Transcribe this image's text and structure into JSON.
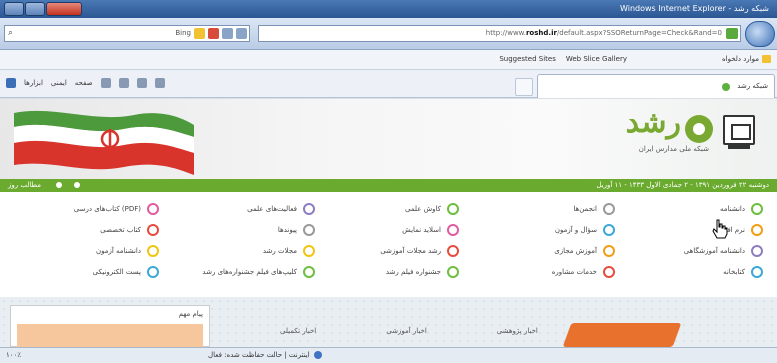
{
  "window": {
    "title": "Windows Internet Explorer - شبکه رشد",
    "controls": [
      "minimize",
      "maximize",
      "close"
    ]
  },
  "address_bar": {
    "url_prefix": "http://www.",
    "url_domain": "roshd.ir",
    "url_rest": "/default.aspx?SSOReturnPage=Check&Rand=0",
    "search_provider": "Bing",
    "search_icon": "search-icon",
    "nav_icon": "back-forward-icon"
  },
  "favorites_bar": {
    "label": "موارد دلخواه",
    "items": [
      "Web Slice Gallery",
      "Suggested Sites"
    ]
  },
  "command_bar": {
    "tab_title": "شبکه رشد",
    "commands": [
      "ابزارها",
      "ایمنی",
      "صفحه"
    ]
  },
  "page": {
    "logo_text": "رشد",
    "logo_subtitle": "شبکه ملی مدارس ایران",
    "date_text": "دوشنبه ۲۲ فروردین ۱۳۹۱ - ۲ جمادی الاول ۱۴۳۳ - ۱۱ آوریل",
    "greenbar_left": "مطالب روز",
    "menu": {
      "col1": [
        {
          "label": "دانشنامه",
          "color": "#6cbf3c"
        },
        {
          "label": "نرم افزار",
          "color": "#f39c12"
        },
        {
          "label": "دانشنامه آموزشگاهی",
          "color": "#8e7cc3"
        },
        {
          "label": "کتابخانه",
          "color": "#3aa7d8"
        }
      ],
      "col2": [
        {
          "label": "انجمن‌ها",
          "color": "#999999"
        },
        {
          "label": "سؤال و آزمون",
          "color": "#3aa7d8"
        },
        {
          "label": "آموزش مجازی",
          "color": "#f39c12"
        },
        {
          "label": "خدمات مشاوره",
          "color": "#e84a3c"
        }
      ],
      "col3": [
        {
          "label": "کاوش علمی",
          "color": "#6cbf3c"
        },
        {
          "label": "اسلاید نمایش",
          "color": "#e25aa0"
        },
        {
          "label": "رشد مجلات آموزشی",
          "color": "#e84a3c"
        },
        {
          "label": "جشنواره فیلم رشد",
          "color": "#6cbf3c"
        }
      ],
      "col4": [
        {
          "label": "فعالیت‌های علمی",
          "color": "#8e7cc3"
        },
        {
          "label": "پیوندها",
          "color": "#999999"
        },
        {
          "label": "مجلات رشد",
          "color": "#f1c40f"
        },
        {
          "label": "کلیپ‌های فیلم جشنواره‌های رشد",
          "color": "#6cbf3c"
        }
      ],
      "col5": [
        {
          "label": "کتاب‌های درسی (PDF)",
          "color": "#e25aa0"
        },
        {
          "label": "کتاب تخصصی",
          "color": "#e84a3c"
        },
        {
          "label": "دانشنامه آزمون",
          "color": "#f1c40f"
        },
        {
          "label": "پست الکترونیکی",
          "color": "#3aa7d8"
        }
      ]
    },
    "lower": {
      "box_title": "پیام مهم",
      "tabs": [
        "اخبار تکمیلی",
        "اخبار آموزشی",
        "اخبار پژوهشی"
      ]
    }
  },
  "status_bar": {
    "zoom": "۱۰۰٪",
    "zone": "اینترنت | حالت حفاظت شده: فعال"
  }
}
